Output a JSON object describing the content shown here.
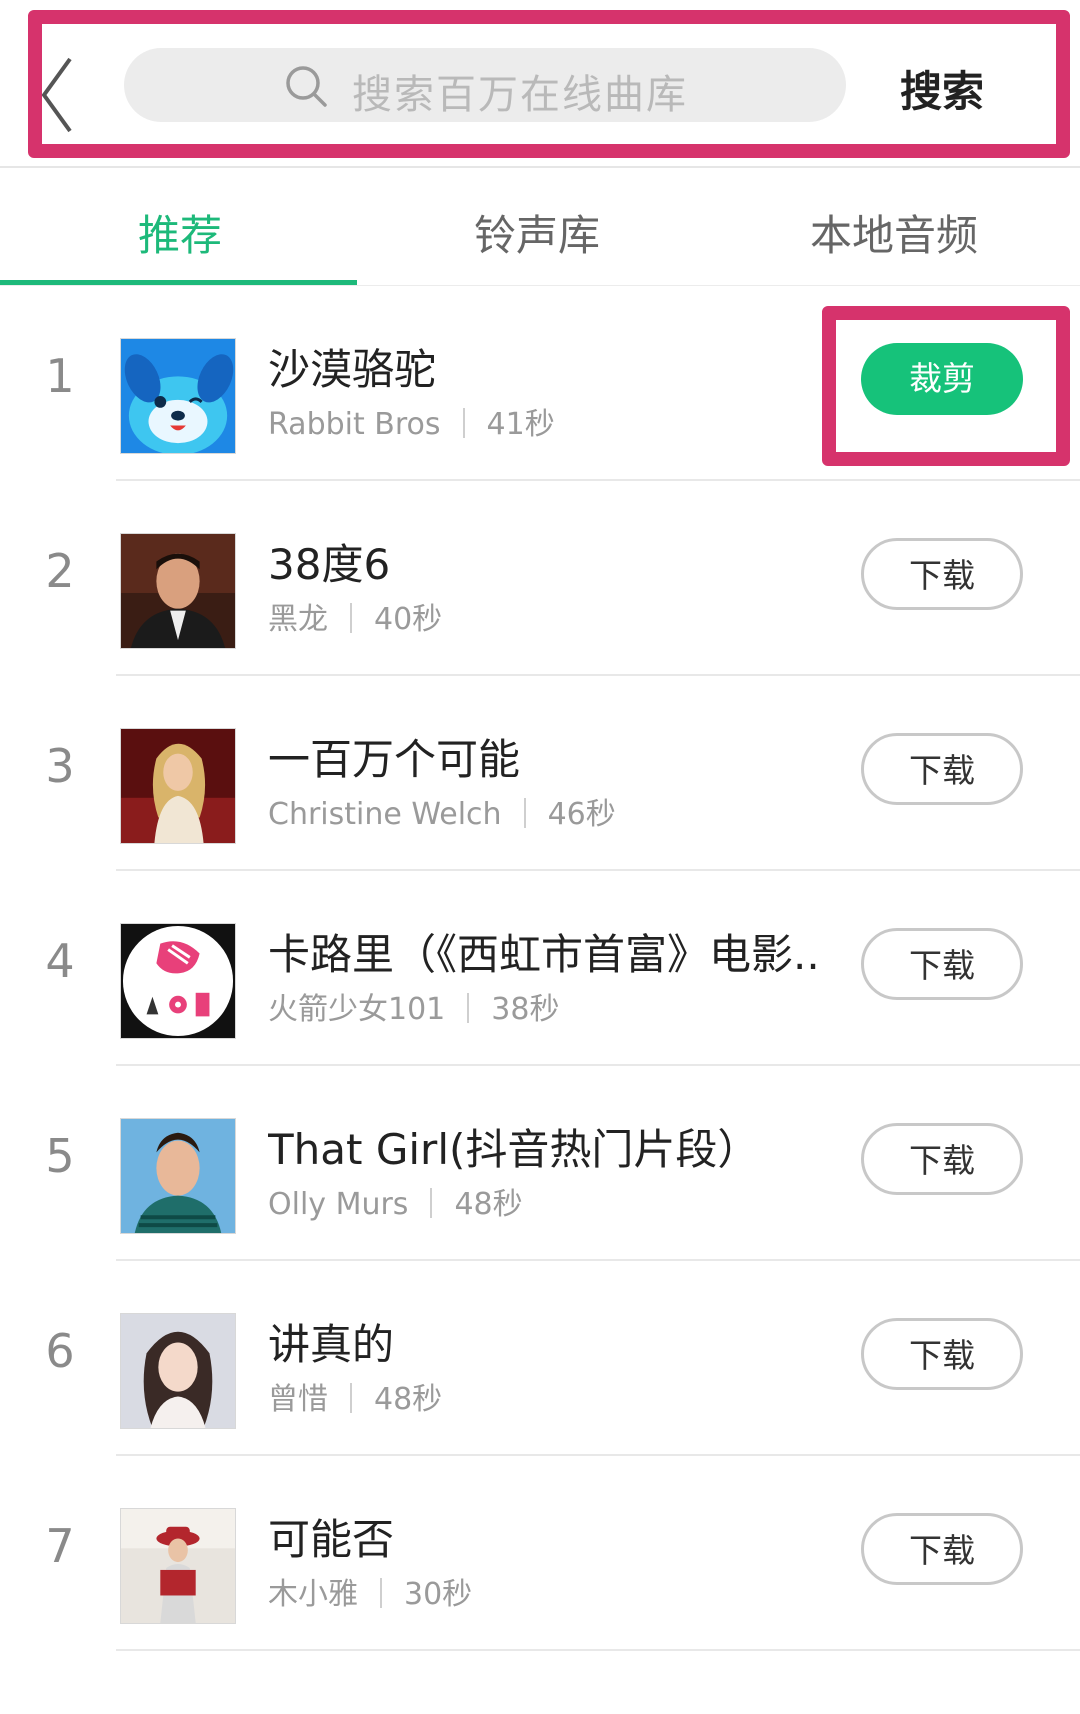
{
  "header": {
    "search_placeholder": "搜索百万在线曲库",
    "search_button": "搜索"
  },
  "tabs": [
    {
      "label": "推荐",
      "active": true
    },
    {
      "label": "铃声库",
      "active": false
    },
    {
      "label": "本地音频",
      "active": false
    }
  ],
  "songs": [
    {
      "rank": "1",
      "title": "沙漠骆驼",
      "artist": "Rabbit Bros",
      "duration": "41秒",
      "action": "裁剪",
      "cover_icon": "blue-dog-cover"
    },
    {
      "rank": "2",
      "title": "38度6",
      "artist": "黑龙",
      "duration": "40秒",
      "action": "下载",
      "cover_icon": "man-portrait-cover"
    },
    {
      "rank": "3",
      "title": "一百万个可能",
      "artist": "Christine Welch",
      "duration": "46秒",
      "action": "下载",
      "cover_icon": "woman-red-room-cover"
    },
    {
      "rank": "4",
      "title": "卡路里（《西虹市首富》电影..",
      "artist": "火箭少女101",
      "duration": "38秒",
      "action": "下载",
      "cover_icon": "rocket-girls-logo-cover"
    },
    {
      "rank": "5",
      "title": "That Girl(抖音热门片段）",
      "artist": "Olly Murs",
      "duration": "48秒",
      "action": "下载",
      "cover_icon": "man-blue-bg-cover"
    },
    {
      "rank": "6",
      "title": "讲真的",
      "artist": "曾惜",
      "duration": "48秒",
      "action": "下载",
      "cover_icon": "woman-portrait-cover"
    },
    {
      "rank": "7",
      "title": "可能否",
      "artist": "木小雅",
      "duration": "30秒",
      "action": "下载",
      "cover_icon": "girl-red-hat-cover"
    }
  ],
  "colors": {
    "accent_green": "#1db97a",
    "highlight_pink": "#d6336c",
    "button_green": "#16c27a"
  }
}
